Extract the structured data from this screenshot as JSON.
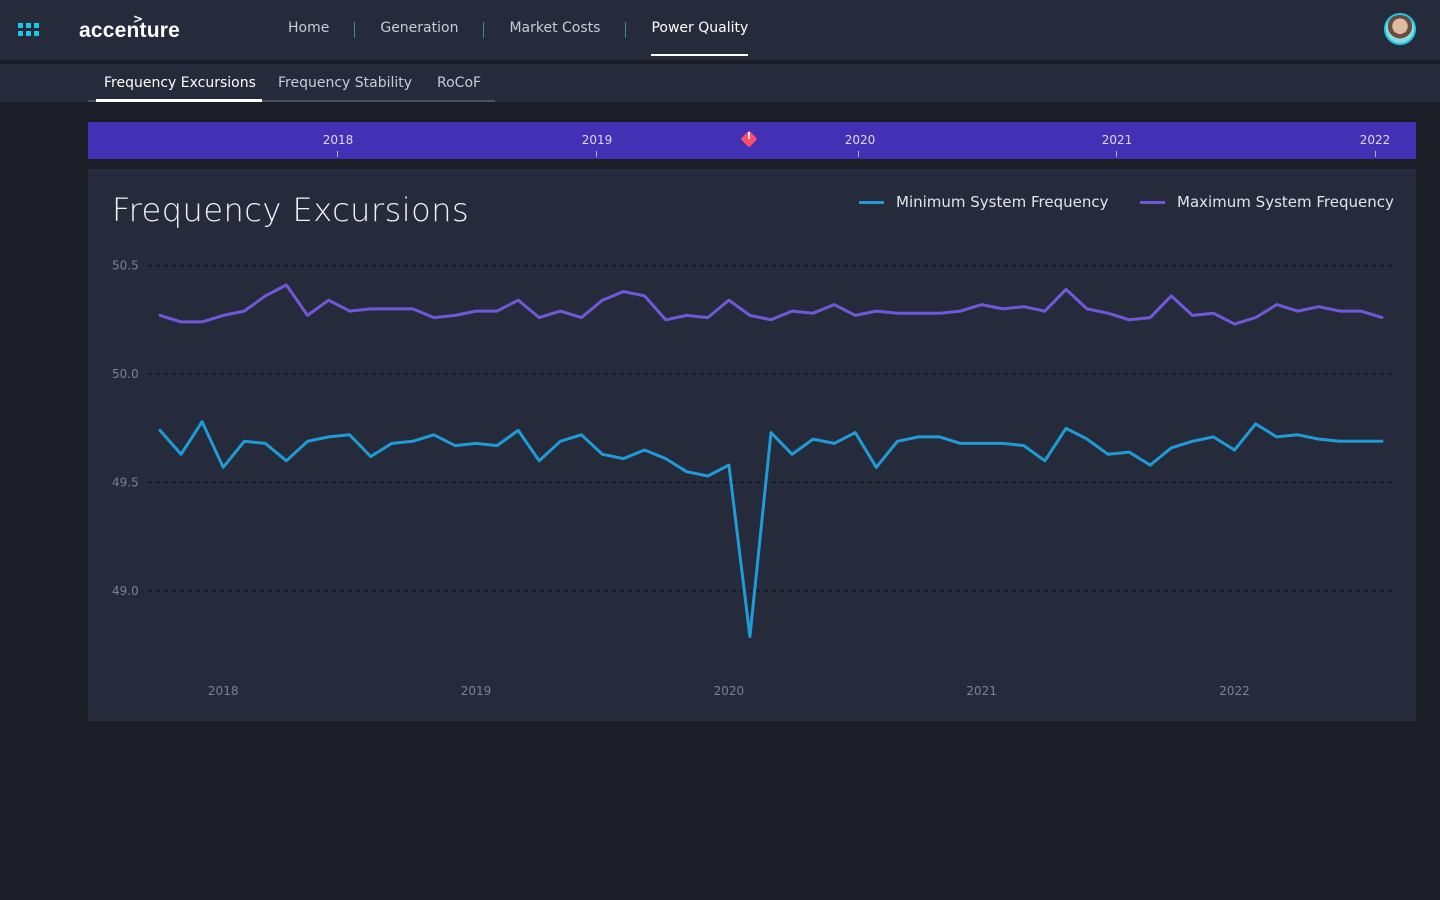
{
  "header": {
    "logo": "accenture",
    "nav": [
      {
        "label": "Home",
        "active": false
      },
      {
        "label": "Generation",
        "active": false
      },
      {
        "label": "Market Costs",
        "active": false
      },
      {
        "label": "Power Quality",
        "active": true
      }
    ]
  },
  "subtabs": [
    {
      "label": "Frequency Excursions",
      "active": true
    },
    {
      "label": "Frequency Stability",
      "active": false
    },
    {
      "label": "RoCoF",
      "active": false
    }
  ],
  "timeline": {
    "labels": [
      "2018",
      "2019",
      "2020",
      "2021",
      "2022"
    ],
    "alert_icon": "alert-diamond-icon"
  },
  "colors": {
    "accent": "#19c7e6",
    "timeline": "#4331b5",
    "min_series": "#1f9bd7",
    "max_series": "#7158d9",
    "alert": "#ff4d6a"
  },
  "chart_data": {
    "type": "line",
    "title": "Frequency Excursions",
    "xlabel": "",
    "ylabel": "",
    "ylim": [
      48.7,
      50.6
    ],
    "yticks": [
      "49.0",
      "49.5",
      "50.0",
      "50.5"
    ],
    "xticks": [
      "2018",
      "2019",
      "2020",
      "2021",
      "2022"
    ],
    "grid": true,
    "legend_position": "top-right",
    "x_start": "2017-10",
    "x_end": "2022-02",
    "series": [
      {
        "name": "Minimum System Frequency",
        "color": "#1f9bd7",
        "values": [
          49.74,
          49.63,
          49.78,
          49.57,
          49.69,
          49.68,
          49.6,
          49.69,
          49.71,
          49.72,
          49.62,
          49.68,
          49.69,
          49.72,
          49.67,
          49.68,
          49.67,
          49.74,
          49.6,
          49.69,
          49.72,
          49.63,
          49.61,
          49.65,
          49.61,
          49.55,
          49.53,
          49.58,
          48.79,
          49.73,
          49.63,
          49.7,
          49.68,
          49.73,
          49.57,
          49.69,
          49.71,
          49.71,
          49.68,
          49.68,
          49.68,
          49.67,
          49.6,
          49.75,
          49.7,
          49.63,
          49.64,
          49.58,
          49.66,
          49.69,
          49.71,
          49.65,
          49.77,
          49.71,
          49.72,
          49.7,
          49.69,
          49.69,
          49.69
        ]
      },
      {
        "name": "Maximum System Frequency",
        "color": "#7158d9",
        "values": [
          50.27,
          50.24,
          50.24,
          50.27,
          50.29,
          50.36,
          50.41,
          50.27,
          50.34,
          50.29,
          50.3,
          50.3,
          50.3,
          50.26,
          50.27,
          50.29,
          50.29,
          50.34,
          50.26,
          50.29,
          50.26,
          50.34,
          50.38,
          50.36,
          50.25,
          50.27,
          50.26,
          50.34,
          50.27,
          50.25,
          50.29,
          50.28,
          50.32,
          50.27,
          50.29,
          50.28,
          50.28,
          50.28,
          50.29,
          50.32,
          50.3,
          50.31,
          50.29,
          50.39,
          50.3,
          50.28,
          50.25,
          50.26,
          50.36,
          50.27,
          50.28,
          50.23,
          50.26,
          50.32,
          50.29,
          50.31,
          50.29,
          50.29,
          50.26
        ]
      }
    ]
  }
}
